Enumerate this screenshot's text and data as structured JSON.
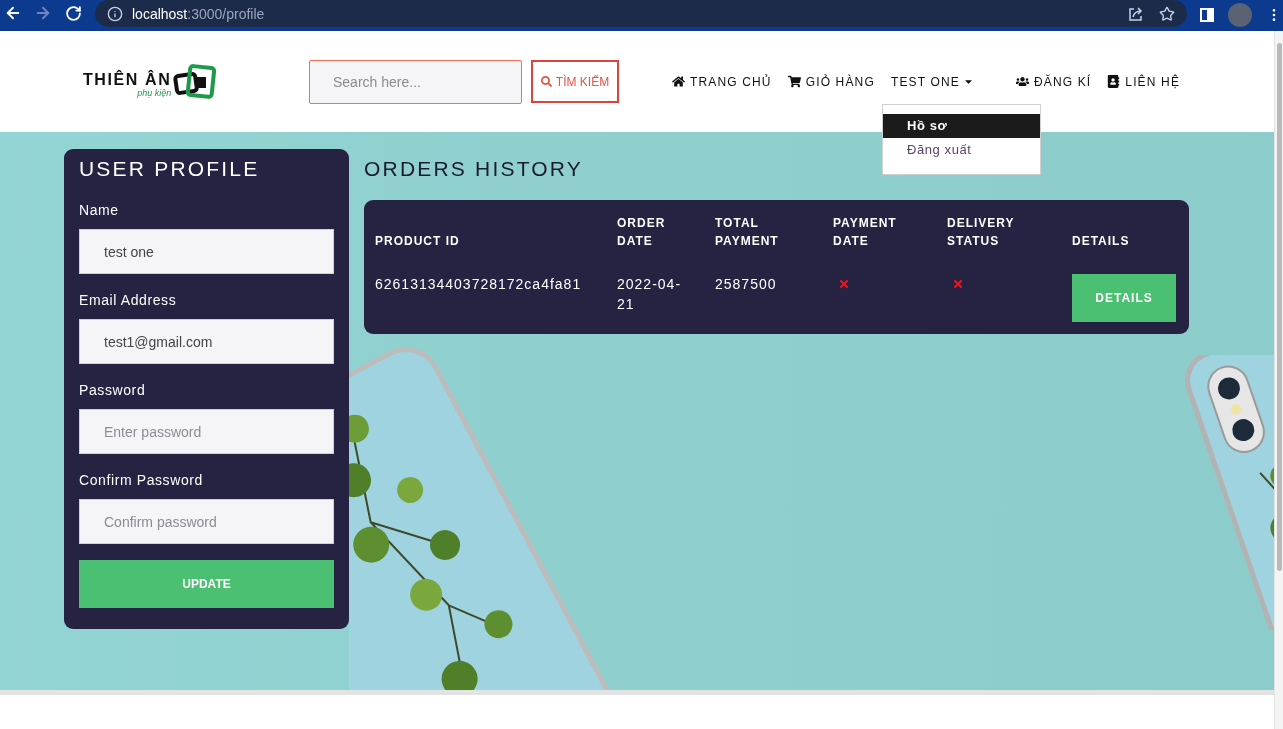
{
  "browser": {
    "forward_disabled": true,
    "url_host": "localhost",
    "url_path": ":3000/profile"
  },
  "header": {
    "logo": {
      "title": "THIÊN ÂN",
      "subtitle": "phụ kiện"
    },
    "search": {
      "placeholder": "Search here...",
      "button": "TÌM KIẾM"
    },
    "nav": [
      {
        "kind": "link",
        "label": "TRANG CHỦ"
      },
      {
        "kind": "link",
        "label": "GIỎ HÀNG"
      },
      {
        "kind": "dropdown",
        "label": "TEST ONE",
        "expanded": true,
        "menu": [
          {
            "label": "Hồ sơ",
            "selected": true
          },
          {
            "label": "Đăng xuất",
            "selected": false
          }
        ]
      },
      {
        "kind": "link",
        "label": "ĐĂNG KÍ"
      },
      {
        "kind": "link",
        "label": "LIÊN HỆ"
      }
    ]
  },
  "profile": {
    "title": "USER PROFILE",
    "fields": [
      {
        "label": "Name",
        "value": "test one"
      },
      {
        "label": "Email Address",
        "value": "test1@gmail.com"
      },
      {
        "label": "Password",
        "placeholder": "Enter password"
      },
      {
        "label": "Confirm Password",
        "placeholder": "Confirm password"
      }
    ],
    "button": "UPDATE"
  },
  "orders": {
    "title": "ORDERS HISTORY",
    "columns": [
      "PRODUCT ID",
      "ORDER DATE",
      "TOTAL PAYMENT",
      "PAYMENT DATE",
      "DELIVERY STATUS",
      "DETAILS"
    ],
    "rows": [
      {
        "product_id": "62613134403728172ca4fa81",
        "order_date": "2022-04-21",
        "total": "2587500",
        "paid": false,
        "delivered": false,
        "button": "DETAILS"
      }
    ]
  }
}
